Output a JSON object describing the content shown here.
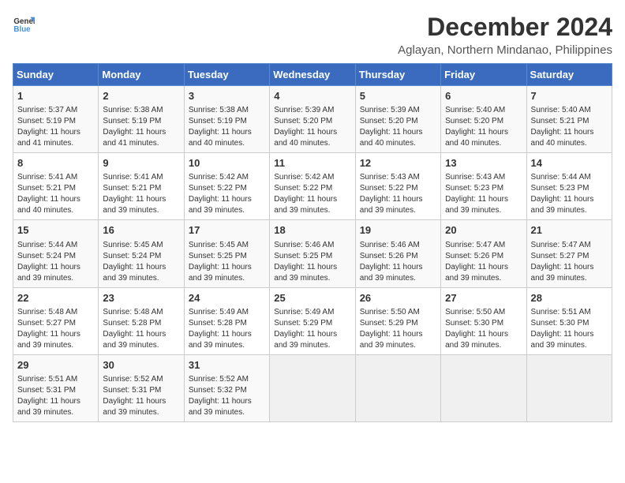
{
  "logo": {
    "text_general": "General",
    "text_blue": "Blue"
  },
  "title": {
    "month": "December 2024",
    "location": "Aglayan, Northern Mindanao, Philippines"
  },
  "headers": [
    "Sunday",
    "Monday",
    "Tuesday",
    "Wednesday",
    "Thursday",
    "Friday",
    "Saturday"
  ],
  "weeks": [
    [
      {
        "day": "1",
        "sunrise": "5:37 AM",
        "sunset": "5:19 PM",
        "daylight": "11 hours and 41 minutes."
      },
      {
        "day": "2",
        "sunrise": "5:38 AM",
        "sunset": "5:19 PM",
        "daylight": "11 hours and 41 minutes."
      },
      {
        "day": "3",
        "sunrise": "5:38 AM",
        "sunset": "5:19 PM",
        "daylight": "11 hours and 40 minutes."
      },
      {
        "day": "4",
        "sunrise": "5:39 AM",
        "sunset": "5:20 PM",
        "daylight": "11 hours and 40 minutes."
      },
      {
        "day": "5",
        "sunrise": "5:39 AM",
        "sunset": "5:20 PM",
        "daylight": "11 hours and 40 minutes."
      },
      {
        "day": "6",
        "sunrise": "5:40 AM",
        "sunset": "5:20 PM",
        "daylight": "11 hours and 40 minutes."
      },
      {
        "day": "7",
        "sunrise": "5:40 AM",
        "sunset": "5:21 PM",
        "daylight": "11 hours and 40 minutes."
      }
    ],
    [
      {
        "day": "8",
        "sunrise": "5:41 AM",
        "sunset": "5:21 PM",
        "daylight": "11 hours and 40 minutes."
      },
      {
        "day": "9",
        "sunrise": "5:41 AM",
        "sunset": "5:21 PM",
        "daylight": "11 hours and 39 minutes."
      },
      {
        "day": "10",
        "sunrise": "5:42 AM",
        "sunset": "5:22 PM",
        "daylight": "11 hours and 39 minutes."
      },
      {
        "day": "11",
        "sunrise": "5:42 AM",
        "sunset": "5:22 PM",
        "daylight": "11 hours and 39 minutes."
      },
      {
        "day": "12",
        "sunrise": "5:43 AM",
        "sunset": "5:22 PM",
        "daylight": "11 hours and 39 minutes."
      },
      {
        "day": "13",
        "sunrise": "5:43 AM",
        "sunset": "5:23 PM",
        "daylight": "11 hours and 39 minutes."
      },
      {
        "day": "14",
        "sunrise": "5:44 AM",
        "sunset": "5:23 PM",
        "daylight": "11 hours and 39 minutes."
      }
    ],
    [
      {
        "day": "15",
        "sunrise": "5:44 AM",
        "sunset": "5:24 PM",
        "daylight": "11 hours and 39 minutes."
      },
      {
        "day": "16",
        "sunrise": "5:45 AM",
        "sunset": "5:24 PM",
        "daylight": "11 hours and 39 minutes."
      },
      {
        "day": "17",
        "sunrise": "5:45 AM",
        "sunset": "5:25 PM",
        "daylight": "11 hours and 39 minutes."
      },
      {
        "day": "18",
        "sunrise": "5:46 AM",
        "sunset": "5:25 PM",
        "daylight": "11 hours and 39 minutes."
      },
      {
        "day": "19",
        "sunrise": "5:46 AM",
        "sunset": "5:26 PM",
        "daylight": "11 hours and 39 minutes."
      },
      {
        "day": "20",
        "sunrise": "5:47 AM",
        "sunset": "5:26 PM",
        "daylight": "11 hours and 39 minutes."
      },
      {
        "day": "21",
        "sunrise": "5:47 AM",
        "sunset": "5:27 PM",
        "daylight": "11 hours and 39 minutes."
      }
    ],
    [
      {
        "day": "22",
        "sunrise": "5:48 AM",
        "sunset": "5:27 PM",
        "daylight": "11 hours and 39 minutes."
      },
      {
        "day": "23",
        "sunrise": "5:48 AM",
        "sunset": "5:28 PM",
        "daylight": "11 hours and 39 minutes."
      },
      {
        "day": "24",
        "sunrise": "5:49 AM",
        "sunset": "5:28 PM",
        "daylight": "11 hours and 39 minutes."
      },
      {
        "day": "25",
        "sunrise": "5:49 AM",
        "sunset": "5:29 PM",
        "daylight": "11 hours and 39 minutes."
      },
      {
        "day": "26",
        "sunrise": "5:50 AM",
        "sunset": "5:29 PM",
        "daylight": "11 hours and 39 minutes."
      },
      {
        "day": "27",
        "sunrise": "5:50 AM",
        "sunset": "5:30 PM",
        "daylight": "11 hours and 39 minutes."
      },
      {
        "day": "28",
        "sunrise": "5:51 AM",
        "sunset": "5:30 PM",
        "daylight": "11 hours and 39 minutes."
      }
    ],
    [
      {
        "day": "29",
        "sunrise": "5:51 AM",
        "sunset": "5:31 PM",
        "daylight": "11 hours and 39 minutes."
      },
      {
        "day": "30",
        "sunrise": "5:52 AM",
        "sunset": "5:31 PM",
        "daylight": "11 hours and 39 minutes."
      },
      {
        "day": "31",
        "sunrise": "5:52 AM",
        "sunset": "5:32 PM",
        "daylight": "11 hours and 39 minutes."
      },
      null,
      null,
      null,
      null
    ]
  ],
  "labels": {
    "sunrise": "Sunrise:",
    "sunset": "Sunset:",
    "daylight": "Daylight:"
  }
}
